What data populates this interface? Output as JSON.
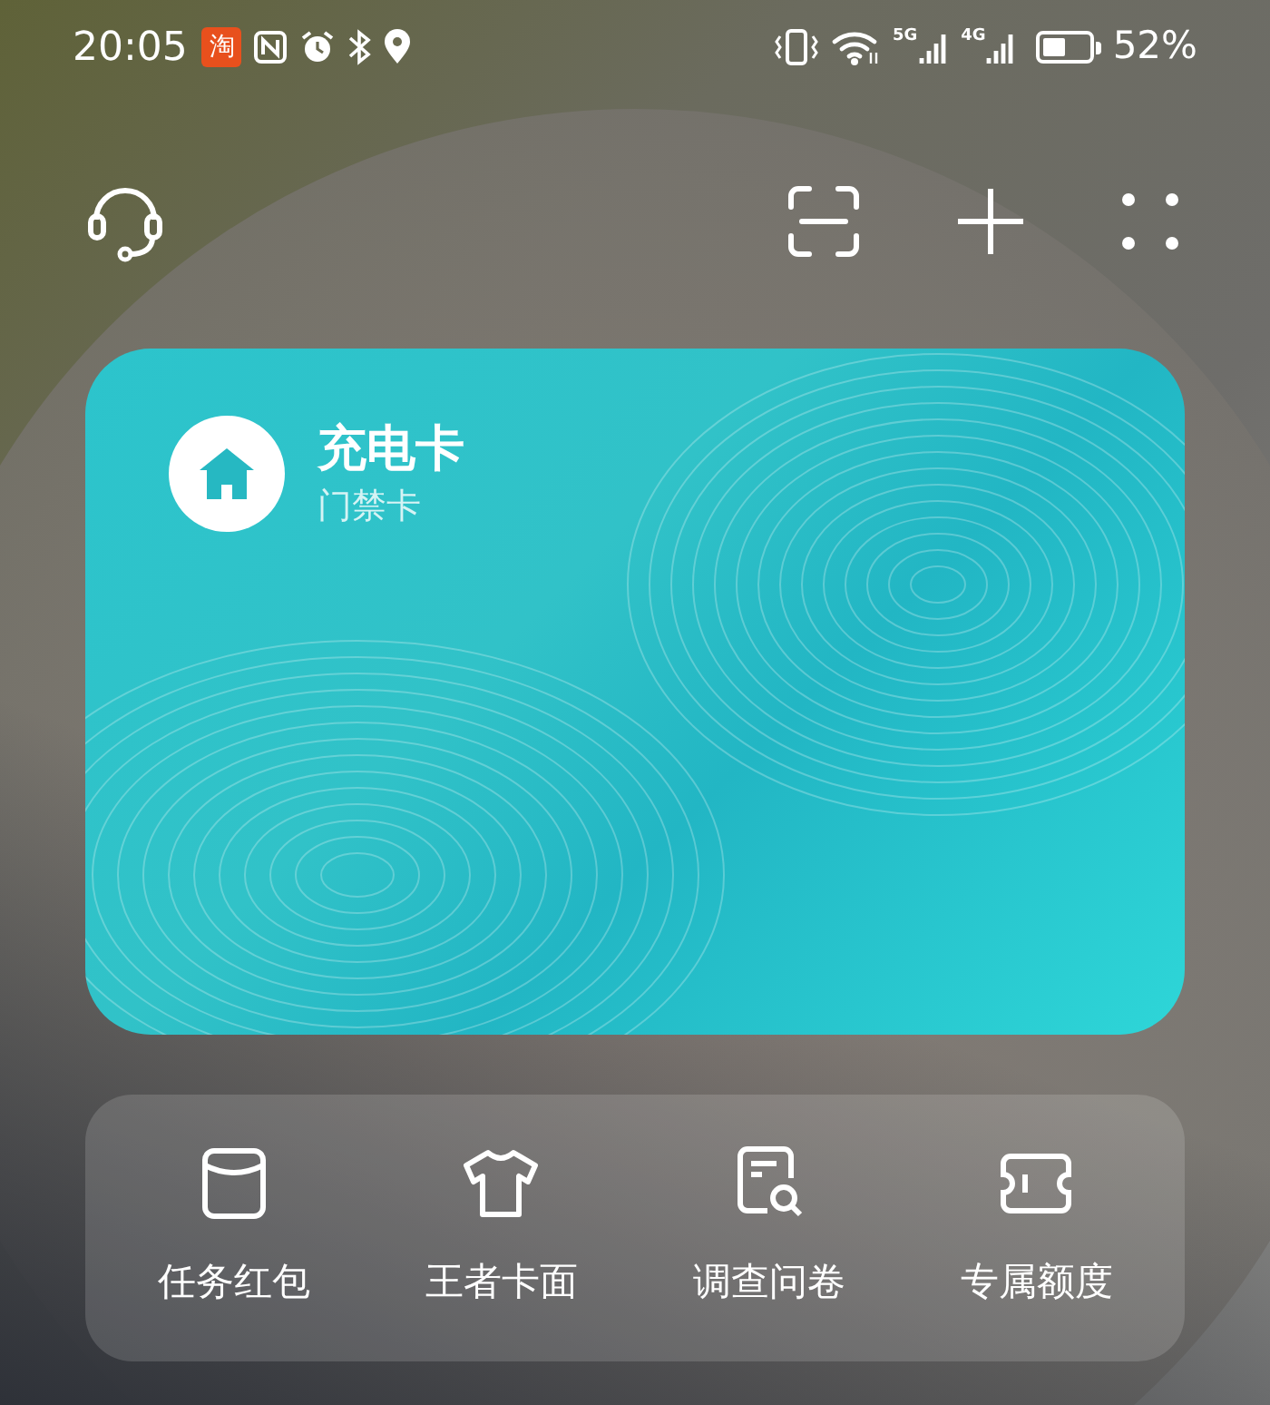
{
  "status_bar": {
    "time": "20:05",
    "app_badge": "淘",
    "network_labels": [
      "5G",
      "4G"
    ],
    "battery_text": "52%"
  },
  "card": {
    "title": "充电卡",
    "subtitle": "门禁卡"
  },
  "shortcuts": [
    {
      "kind": "envelope",
      "label": "任务红包"
    },
    {
      "kind": "shirt",
      "label": "王者卡面"
    },
    {
      "kind": "survey",
      "label": "调查问卷"
    },
    {
      "kind": "ticket",
      "label": "专属额度"
    }
  ]
}
